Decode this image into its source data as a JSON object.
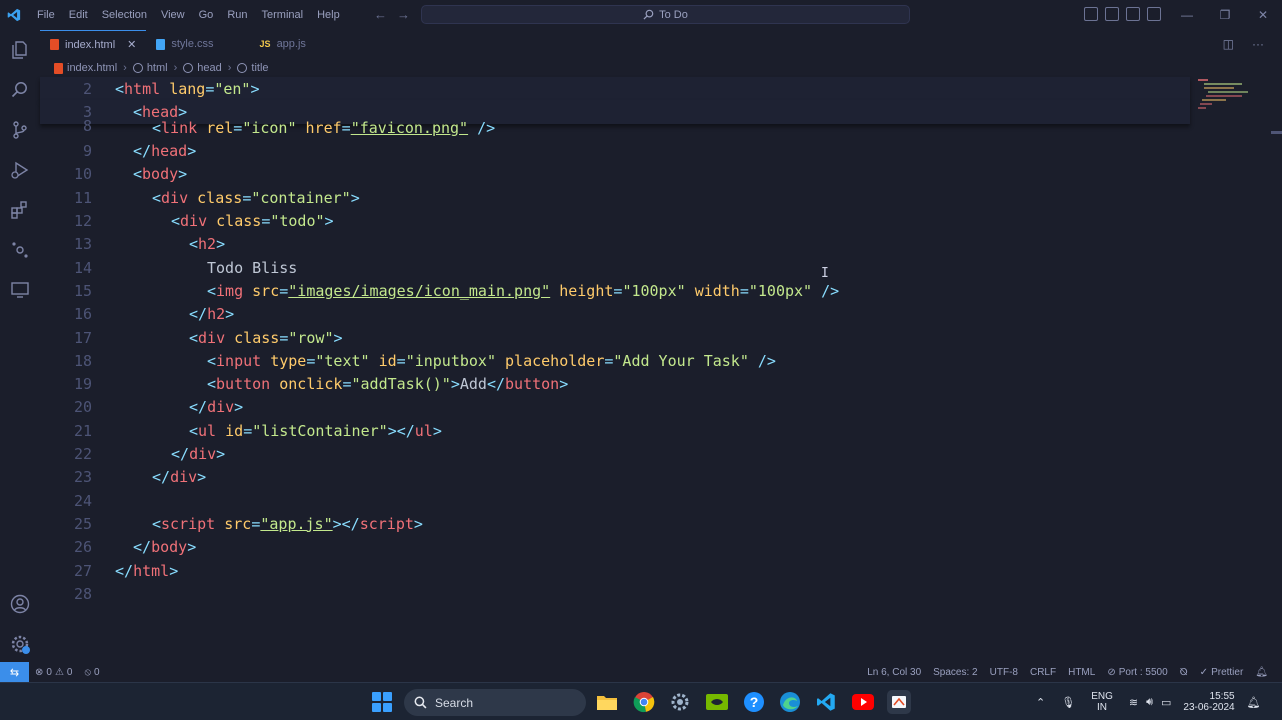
{
  "menu": [
    "File",
    "Edit",
    "Selection",
    "View",
    "Go",
    "Run",
    "Terminal",
    "Help"
  ],
  "command_center": "To Do",
  "tabs": [
    {
      "label": "index.html",
      "type": "html",
      "active": true
    },
    {
      "label": "style.css",
      "type": "css",
      "active": false
    },
    {
      "label": "app.js",
      "type": "js",
      "active": false
    }
  ],
  "js_badge": "JS",
  "breadcrumb": [
    "index.html",
    "html",
    "head",
    "title"
  ],
  "editor": {
    "lines": [
      {
        "n": "2"
      },
      {
        "n": "3"
      },
      {
        "n": "8"
      },
      {
        "n": "9"
      },
      {
        "n": "10"
      },
      {
        "n": "11"
      },
      {
        "n": "12"
      },
      {
        "n": "13"
      },
      {
        "n": "14"
      },
      {
        "n": "15"
      },
      {
        "n": "16"
      },
      {
        "n": "17"
      },
      {
        "n": "18"
      },
      {
        "n": "19"
      },
      {
        "n": "20"
      },
      {
        "n": "21"
      },
      {
        "n": "22"
      },
      {
        "n": "23"
      },
      {
        "n": "24"
      },
      {
        "n": "25"
      },
      {
        "n": "26"
      },
      {
        "n": "27"
      },
      {
        "n": "28"
      }
    ],
    "text": {
      "lang_en": "\"en\"",
      "icon": "\"icon\"",
      "favicon": "\"favicon.png\"",
      "container": "\"container\"",
      "todo": "\"todo\"",
      "todo_bliss": "Todo Bliss",
      "img_src": "\"images/images/icon_main.png\"",
      "h100": "\"100px\"",
      "w100": "\"100px\"",
      "row": "\"row\"",
      "text_type": "\"text\"",
      "inputbox": "\"inputbox\"",
      "placeholder": "\"Add Your Task\"",
      "onclick": "\"addTask()\"",
      "add": "Add",
      "listcontainer": "\"listContainer\"",
      "appjs": "\"app.js\""
    }
  },
  "statusbar": {
    "errors": "0",
    "warnings": "0",
    "ports": "0",
    "position": "Ln 6, Col 30",
    "spaces": "Spaces: 2",
    "encoding": "UTF-8",
    "eol": "CRLF",
    "language": "HTML",
    "port": "Port : 5500",
    "prettier": "Prettier"
  },
  "taskbar": {
    "search": "Search",
    "lang_top": "ENG",
    "lang_bottom": "IN",
    "time": "15:55",
    "date": "23-06-2024"
  },
  "colors": {
    "accent": "#3b8eea",
    "tag": "#f07178",
    "attr": "#ffcb6b",
    "string": "#c3e88d",
    "editor_bg": "#1b1e2b"
  }
}
